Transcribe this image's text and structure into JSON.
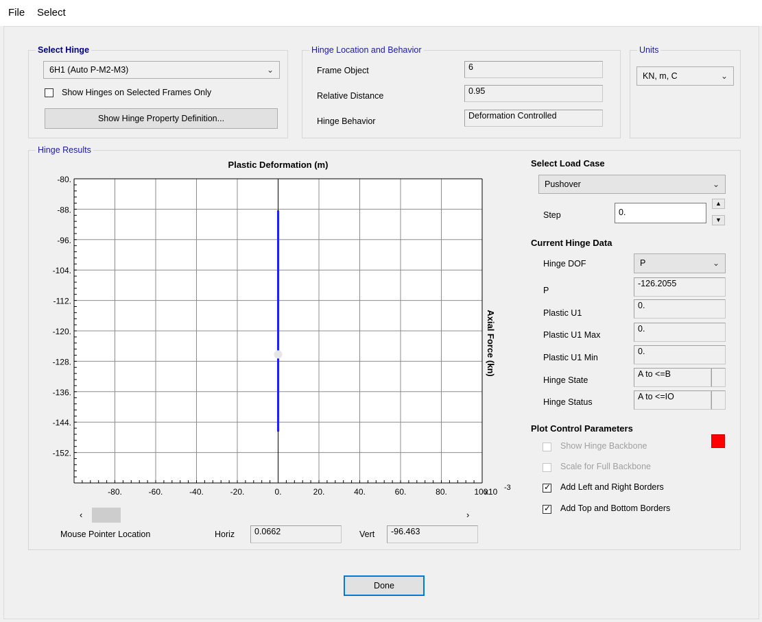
{
  "menu": [
    "File",
    "Select"
  ],
  "select_hinge": {
    "legend": "Select Hinge",
    "hinge_value": "6H1 (Auto P-M2-M3)",
    "show_selected_label": "Show Hinges on Selected Frames Only",
    "show_definition_button": "Show Hinge Property Definition..."
  },
  "location": {
    "legend": "Hinge Location and Behavior",
    "frame_object_label": "Frame Object",
    "frame_object_value": "6",
    "relative_distance_label": "Relative Distance",
    "relative_distance_value": "0.95",
    "hinge_behavior_label": "Hinge Behavior",
    "hinge_behavior_value": "Deformation Controlled"
  },
  "units": {
    "legend": "Units",
    "value": "KN, m, C"
  },
  "hinge_results": {
    "legend": "Hinge Results",
    "mouse_pointer_label": "Mouse Pointer Location",
    "horiz_label": "Horiz",
    "horiz_value": "0.0662",
    "vert_label": "Vert",
    "vert_value": "-96.463"
  },
  "right": {
    "select_load_case_title": "Select Load Case",
    "load_case": "Pushover",
    "step_label": "Step",
    "step_value": "0.",
    "current_hinge_data_title": "Current Hinge Data",
    "hinge_dof_label": "Hinge DOF",
    "hinge_dof_value": "P",
    "p_label": "P",
    "p_value": "-126.2055",
    "plastic_u1_label": "Plastic U1",
    "plastic_u1_value": "0.",
    "plastic_u1_max_label": "Plastic U1 Max",
    "plastic_u1_max_value": "0.",
    "plastic_u1_min_label": "Plastic U1 Min",
    "plastic_u1_min_value": "0.",
    "hinge_state_label": "Hinge State",
    "hinge_state_value": "A to <=B",
    "hinge_status_label": "Hinge Status",
    "hinge_status_value": "A to <=IO",
    "plot_control_title": "Plot Control Parameters",
    "show_backbone_label": "Show Hinge Backbone",
    "scale_backbone_label": "Scale for Full Backbone",
    "add_lr_borders_label": "Add Left and Right Borders",
    "add_tb_borders_label": "Add Top and Bottom Borders",
    "backbone_color": "#ff0000",
    "add_lr_checked": true,
    "add_tb_checked": true
  },
  "done_button": "Done",
  "chart_data": {
    "type": "line",
    "title": "Plastic Deformation  (m)",
    "ylabel": "Axial Force  (kn)",
    "x_multiplier_label": "x10",
    "x_multiplier_exp": "-3",
    "xlim": [
      -100,
      100
    ],
    "ylim": [
      -160,
      -80
    ],
    "x_ticks": [
      -80,
      -60,
      -40,
      -20,
      0,
      20,
      40,
      60,
      80,
      100
    ],
    "x_tick_labels": [
      "-80.",
      "-60.",
      "-40.",
      "-20.",
      "0.",
      "20.",
      "40.",
      "60.",
      "80.",
      "100."
    ],
    "y_ticks": [
      -80,
      -88,
      -96,
      -104,
      -112,
      -120,
      -128,
      -136,
      -144,
      -152
    ],
    "y_tick_labels": [
      "-80.",
      "-88.",
      "-96.",
      "-104.",
      "-112.",
      "-120.",
      "-128.",
      "-136.",
      "-144.",
      "-152."
    ],
    "grid": true,
    "series": [
      {
        "color": "#1f1fff",
        "points": [
          [
            0,
            -88.3
          ],
          [
            0,
            -146.5
          ]
        ]
      }
    ],
    "marker": {
      "x": 0,
      "y": -126.2
    }
  }
}
